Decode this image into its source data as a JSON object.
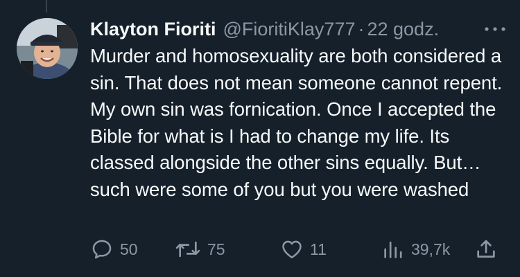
{
  "tweet": {
    "author_name": "Klayton Fioriti",
    "handle": "@FioritiKlay777",
    "separator": "·",
    "time": "22 godz.",
    "text": "Murder and homosexuality are both considered a sin. That does not mean someone cannot repent. My own sin was fornication. Once I accepted the Bible for what is I had to change my life. Its classed alongside the other sins equally. But…such were some of you but you were washed"
  },
  "actions": {
    "replies": "50",
    "retweets": "75",
    "likes": "11",
    "views": "39,7k"
  },
  "icons": {
    "reply": "reply-icon",
    "retweet": "retweet-icon",
    "like": "heart-icon",
    "views": "analytics-icon",
    "share": "share-icon",
    "more": "more-icon"
  },
  "colors": {
    "background": "#15202b",
    "primary_text": "#f7f9f9",
    "secondary_text": "#8b98a5"
  }
}
